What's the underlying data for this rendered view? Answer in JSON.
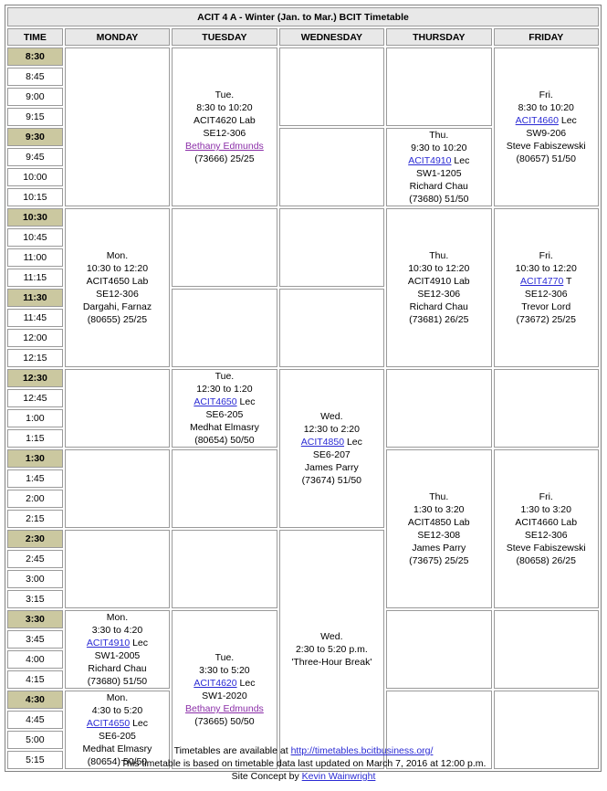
{
  "title": "ACIT 4 A - Winter (Jan. to Mar.) BCIT Timetable",
  "headers": [
    "TIME",
    "MONDAY",
    "TUESDAY",
    "WEDNESDAY",
    "THURSDAY",
    "FRIDAY"
  ],
  "times": [
    "8:30",
    "8:45",
    "9:00",
    "9:15",
    "9:30",
    "9:45",
    "10:00",
    "10:15",
    "10:30",
    "10:45",
    "11:00",
    "11:15",
    "11:30",
    "11:45",
    "12:00",
    "12:15",
    "12:30",
    "12:45",
    "1:00",
    "1:15",
    "1:30",
    "1:45",
    "2:00",
    "2:15",
    "2:30",
    "2:45",
    "3:00",
    "3:15",
    "3:30",
    "3:45",
    "4:00",
    "4:15",
    "4:30",
    "4:45",
    "5:00",
    "5:15"
  ],
  "classes": {
    "tue_830": {
      "day": "Tue.",
      "time": "8:30 to 10:20",
      "course": "ACIT4620 Lab",
      "room": "SE12-306",
      "instructor": "Bethany Edmunds",
      "crn": "(73666) 25/25"
    },
    "fri_830": {
      "day": "Fri.",
      "time": "8:30 to 10:20",
      "course": "ACIT4660",
      "type": "Lec",
      "room": "SW9-206",
      "instructor": "Steve Fabiszewski",
      "crn": "(80657) 51/50"
    },
    "thu_930": {
      "day": "Thu.",
      "time": "9:30 to 10:20",
      "course": "ACIT4910",
      "type": "Lec",
      "room": "SW1-1205",
      "instructor": "Richard Chau",
      "crn": "(73680) 51/50"
    },
    "mon_1030": {
      "day": "Mon.",
      "time": "10:30 to 12:20",
      "course": "ACIT4650 Lab",
      "room": "SE12-306",
      "instructor": "Dargahi, Farnaz",
      "crn": "(80655) 25/25"
    },
    "thu_1030": {
      "day": "Thu.",
      "time": "10:30 to 12:20",
      "course": "ACIT4910 Lab",
      "room": "SE12-306",
      "instructor": "Richard Chau",
      "crn": "(73681) 26/25"
    },
    "fri_1030": {
      "day": "Fri.",
      "time": "10:30 to 12:20",
      "course": "ACIT4770",
      "type": "T",
      "room": "SE12-306",
      "instructor": "Trevor Lord",
      "crn": "(73672) 25/25"
    },
    "tue_1230": {
      "day": "Tue.",
      "time": "12:30 to 1:20",
      "course": "ACIT4650",
      "type": "Lec",
      "room": "SE6-205",
      "instructor": "Medhat Elmasry",
      "crn": "(80654) 50/50"
    },
    "wed_1230": {
      "day": "Wed.",
      "time": "12:30 to 2:20",
      "course": "ACIT4850",
      "type": "Lec",
      "room": "SE6-207",
      "instructor": "James Parry",
      "crn": "(73674) 51/50"
    },
    "thu_130": {
      "day": "Thu.",
      "time": "1:30 to 3:20",
      "course": "ACIT4850 Lab",
      "room": "SE12-308",
      "instructor": "James Parry",
      "crn": "(73675) 25/25"
    },
    "fri_130": {
      "day": "Fri.",
      "time": "1:30 to 3:20",
      "course": "ACIT4660 Lab",
      "room": "SE12-306",
      "instructor": "Steve Fabiszewski",
      "crn": "(80658) 26/25"
    },
    "wed_230": {
      "day": "Wed.",
      "time": "2:30 to 5:20 p.m.",
      "note": "'Three-Hour Break'"
    },
    "mon_330": {
      "day": "Mon.",
      "time": "3:30 to 4:20",
      "course": "ACIT4910",
      "type": "Lec",
      "room": "SW1-2005",
      "instructor": "Richard Chau",
      "crn": "(73680) 51/50"
    },
    "tue_330": {
      "day": "Tue.",
      "time": "3:30 to 5:20",
      "course": "ACIT4620",
      "type": "Lec",
      "room": "SW1-2020",
      "instructor": "Bethany Edmunds",
      "crn": "(73665) 50/50"
    },
    "mon_430": {
      "day": "Mon.",
      "time": "4:30 to 5:20",
      "course": "ACIT4650",
      "type": "Lec",
      "room": "SE6-205",
      "instructor": "Medhat Elmasry",
      "crn": "(80654) 50/50"
    }
  },
  "footer": {
    "line1_prefix": "Timetables are available at ",
    "line1_link": "http://timetables.bcitbusiness.org/",
    "line2": "This timetable is based on timetable data last updated on March 7, 2016 at 12:00 p.m.",
    "line3_prefix": "Site Concept by ",
    "line3_link": "Kevin Wainwright"
  },
  "colors": {
    "hour_bg": "#cbc8a0",
    "header_bg": "#e8e8e8",
    "link": "#2a2ad4",
    "visited_link": "#8b2ea8"
  }
}
